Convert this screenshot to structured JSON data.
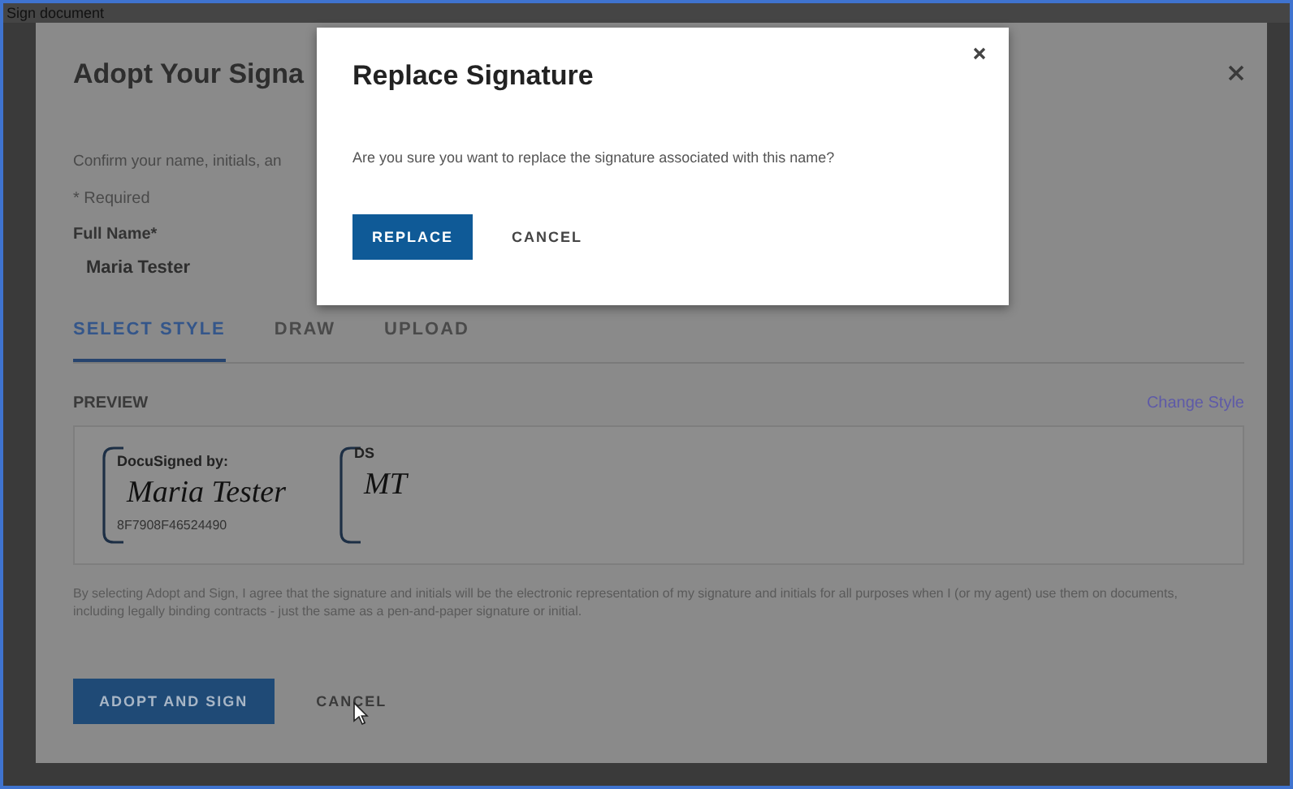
{
  "window": {
    "title": "Sign document"
  },
  "adopt_dialog": {
    "title": "Adopt Your Signa",
    "intro": "Confirm your name, initials, an",
    "required_note": "* Required",
    "full_name": {
      "label": "Full Name*",
      "value": "Maria Tester"
    },
    "tabs": [
      {
        "label": "SELECT STYLE",
        "selected": true
      },
      {
        "label": "DRAW",
        "selected": false
      },
      {
        "label": "UPLOAD",
        "selected": false
      }
    ],
    "preview_label": "PREVIEW",
    "change_style": "Change Style",
    "signature": {
      "caption": "DocuSigned by:",
      "name": "Maria Tester",
      "id": "8F7908F46524490"
    },
    "initials": {
      "caption": "DS",
      "value": "MT"
    },
    "consent": "By selecting Adopt and Sign, I agree that the signature and initials will be the electronic representation of my signature and initials for all purposes when I (or my agent) use them on documents, including legally binding contracts - just the same as a pen-and-paper signature or initial.",
    "buttons": [
      "ADOPT AND SIGN",
      "CANCEL"
    ]
  },
  "replace_dialog": {
    "title": "Replace Signature",
    "message": "Are you sure you want to replace the signature associated with this name?",
    "buttons": [
      "REPLACE",
      "CANCEL"
    ]
  }
}
